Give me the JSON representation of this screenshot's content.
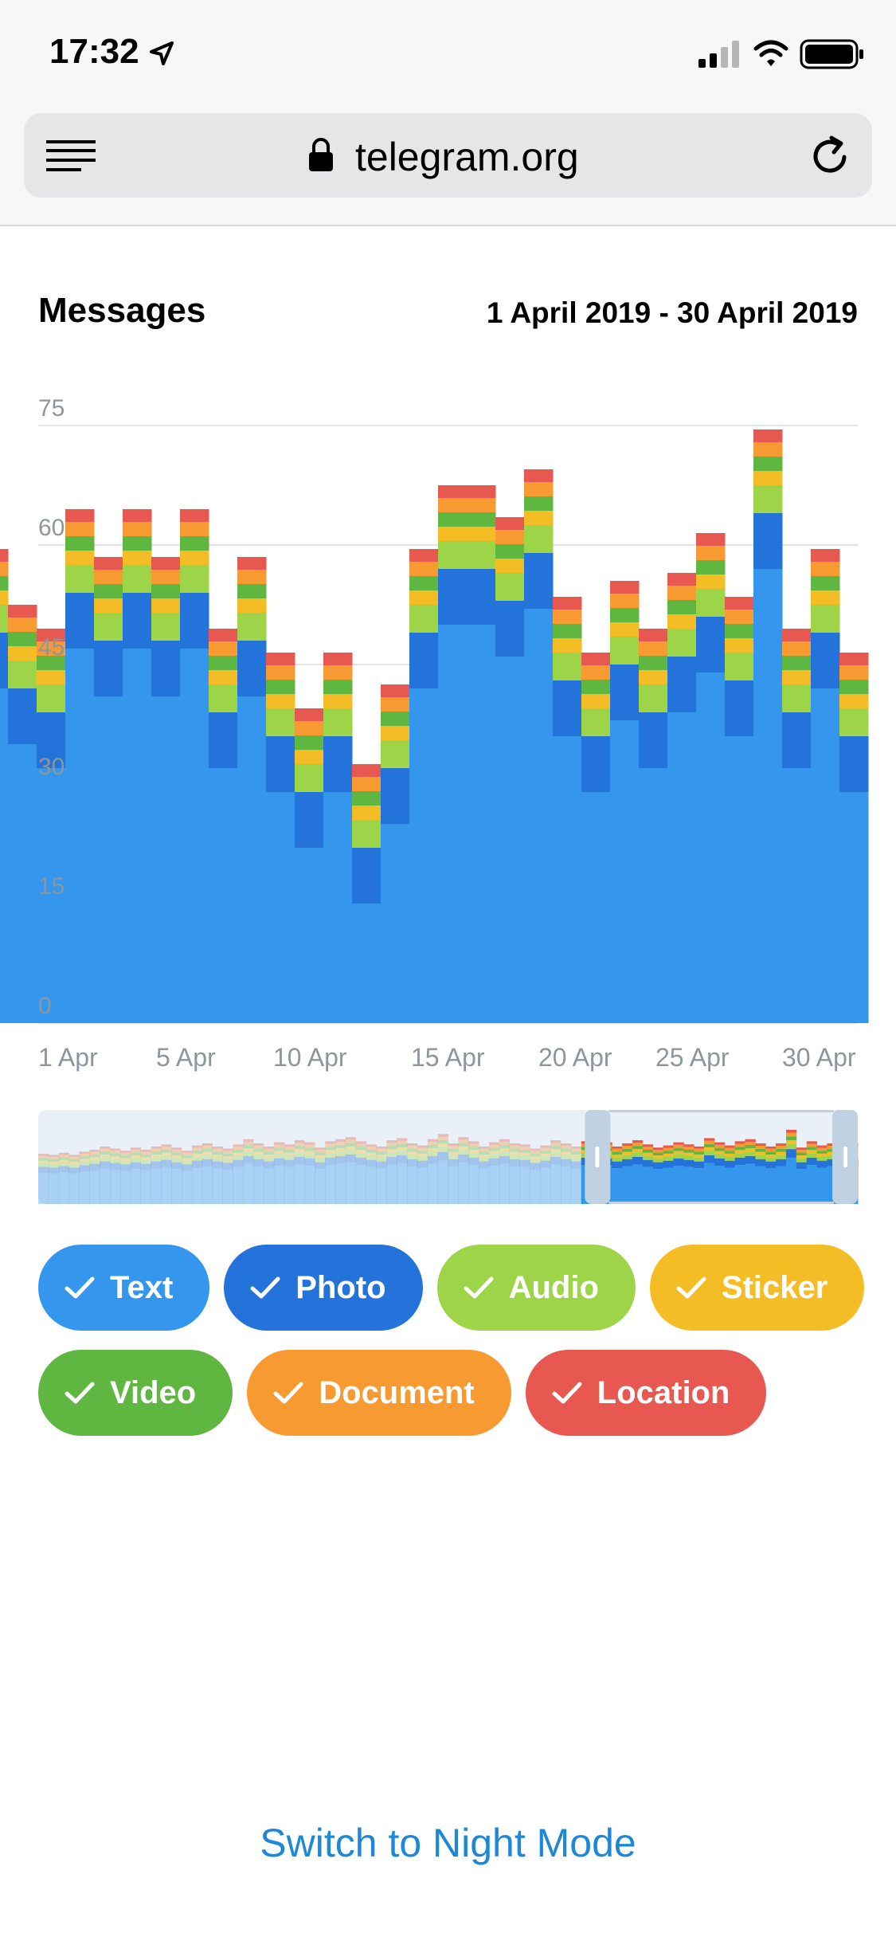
{
  "status_bar": {
    "time": "17:32"
  },
  "browser": {
    "url": "telegram.org"
  },
  "chart_header": {
    "title": "Messages",
    "date_range": "1 April 2019 - 30 April 2019"
  },
  "chart_data": {
    "type": "bar",
    "stacked": true,
    "title": "Messages",
    "ylim": [
      0,
      75
    ],
    "y_ticks": [
      0,
      15,
      30,
      45,
      60,
      75
    ],
    "x_tick_labels": [
      "1 Apr",
      "5 Apr",
      "10 Apr",
      "15 Apr",
      "20 Apr",
      "25 Apr",
      "30 Apr"
    ],
    "grid": true,
    "categories": [
      "31 Mar",
      "1 Apr",
      "2 Apr",
      "3 Apr",
      "4 Apr",
      "5 Apr",
      "6 Apr",
      "7 Apr",
      "8 Apr",
      "9 Apr",
      "10 Apr",
      "11 Apr",
      "12 Apr",
      "13 Apr",
      "14 Apr",
      "15 Apr",
      "16 Apr",
      "17 Apr",
      "18 Apr",
      "19 Apr",
      "20 Apr",
      "21 Apr",
      "22 Apr",
      "23 Apr",
      "24 Apr",
      "25 Apr",
      "26 Apr",
      "27 Apr",
      "28 Apr",
      "29 Apr",
      "30 Apr"
    ],
    "series": [
      {
        "name": "Text",
        "color": "#3497ED",
        "values": [
          42,
          35,
          32,
          47,
          41,
          47,
          41,
          47,
          32,
          41,
          29,
          22,
          29,
          15,
          25,
          42,
          50,
          50,
          46,
          52,
          36,
          29,
          38,
          32,
          39,
          44,
          36,
          57,
          32,
          42,
          29
        ]
      },
      {
        "name": "Photo",
        "color": "#2373DB",
        "values": [
          7,
          7,
          7,
          7,
          7,
          7,
          7,
          7,
          7,
          7,
          7,
          7,
          7,
          7,
          7,
          7,
          7,
          7,
          7,
          7,
          7,
          7,
          7,
          7,
          7,
          7,
          7,
          7,
          7,
          7,
          7
        ]
      },
      {
        "name": "Audio",
        "color": "#9ED448",
        "values": [
          3.5,
          3.5,
          3.5,
          3.5,
          3.5,
          3.5,
          3.5,
          3.5,
          3.5,
          3.5,
          3.5,
          3.5,
          3.5,
          3.5,
          3.5,
          3.5,
          3.5,
          3.5,
          3.5,
          3.5,
          3.5,
          3.5,
          3.5,
          3.5,
          3.5,
          3.5,
          3.5,
          3.5,
          3.5,
          3.5,
          3.5
        ]
      },
      {
        "name": "Sticker",
        "color": "#F5BD25",
        "values": [
          1.8,
          1.8,
          1.8,
          1.8,
          1.8,
          1.8,
          1.8,
          1.8,
          1.8,
          1.8,
          1.8,
          1.8,
          1.8,
          1.8,
          1.8,
          1.8,
          1.8,
          1.8,
          1.8,
          1.8,
          1.8,
          1.8,
          1.8,
          1.8,
          1.8,
          1.8,
          1.8,
          1.8,
          1.8,
          1.8,
          1.8
        ]
      },
      {
        "name": "Video",
        "color": "#5FB641",
        "values": [
          1.8,
          1.8,
          1.8,
          1.8,
          1.8,
          1.8,
          1.8,
          1.8,
          1.8,
          1.8,
          1.8,
          1.8,
          1.8,
          1.8,
          1.8,
          1.8,
          1.8,
          1.8,
          1.8,
          1.8,
          1.8,
          1.8,
          1.8,
          1.8,
          1.8,
          1.8,
          1.8,
          1.8,
          1.8,
          1.8,
          1.8
        ]
      },
      {
        "name": "Document",
        "color": "#F79A32",
        "values": [
          1.8,
          1.8,
          1.8,
          1.8,
          1.8,
          1.8,
          1.8,
          1.8,
          1.8,
          1.8,
          1.8,
          1.8,
          1.8,
          1.8,
          1.8,
          1.8,
          1.8,
          1.8,
          1.8,
          1.8,
          1.8,
          1.8,
          1.8,
          1.8,
          1.8,
          1.8,
          1.8,
          1.8,
          1.8,
          1.8,
          1.8
        ]
      },
      {
        "name": "Location",
        "color": "#E65850",
        "values": [
          1.6,
          1.6,
          1.6,
          1.6,
          1.6,
          1.6,
          1.6,
          1.6,
          1.6,
          1.6,
          1.6,
          1.6,
          1.6,
          1.6,
          1.6,
          1.6,
          1.6,
          1.6,
          1.6,
          1.6,
          1.6,
          1.6,
          1.6,
          1.6,
          1.6,
          1.6,
          1.6,
          1.6,
          1.6,
          1.6,
          1.6
        ]
      }
    ]
  },
  "preview": {
    "overview_totals": [
      48,
      47,
      49,
      47,
      50,
      52,
      55,
      53,
      51,
      54,
      52,
      55,
      57,
      54,
      51,
      56,
      58,
      55,
      53,
      57,
      62,
      58,
      55,
      59,
      57,
      61,
      59,
      54,
      60,
      62,
      64,
      60,
      57,
      55,
      61,
      63,
      58,
      56,
      62,
      67,
      58,
      64,
      60,
      55,
      59,
      62,
      58,
      57,
      53,
      56,
      61,
      58,
      55,
      60,
      63,
      59,
      55,
      58,
      61,
      57,
      54,
      56,
      59,
      57,
      55,
      63,
      59,
      56,
      60,
      62,
      58,
      55,
      58,
      71,
      54,
      60,
      56,
      58,
      62,
      58
    ],
    "window_start_fraction": 0.667,
    "window_end_fraction": 1.0
  },
  "filters": [
    {
      "label": "Text",
      "color": "#3497ED",
      "checked": true
    },
    {
      "label": "Photo",
      "color": "#2373DB",
      "checked": true
    },
    {
      "label": "Audio",
      "color": "#9ED448",
      "checked": true
    },
    {
      "label": "Sticker",
      "color": "#F5BD25",
      "checked": true
    },
    {
      "label": "Video",
      "color": "#5FB641",
      "checked": true
    },
    {
      "label": "Document",
      "color": "#F79A32",
      "checked": true
    },
    {
      "label": "Location",
      "color": "#E65850",
      "checked": true
    }
  ],
  "footer": {
    "night_mode_label": "Switch to Night Mode"
  },
  "icons": [
    "location-arrow-icon",
    "signal-icon",
    "wifi-icon",
    "battery-icon",
    "menu-icon",
    "lock-icon",
    "reload-icon",
    "check-icon"
  ]
}
